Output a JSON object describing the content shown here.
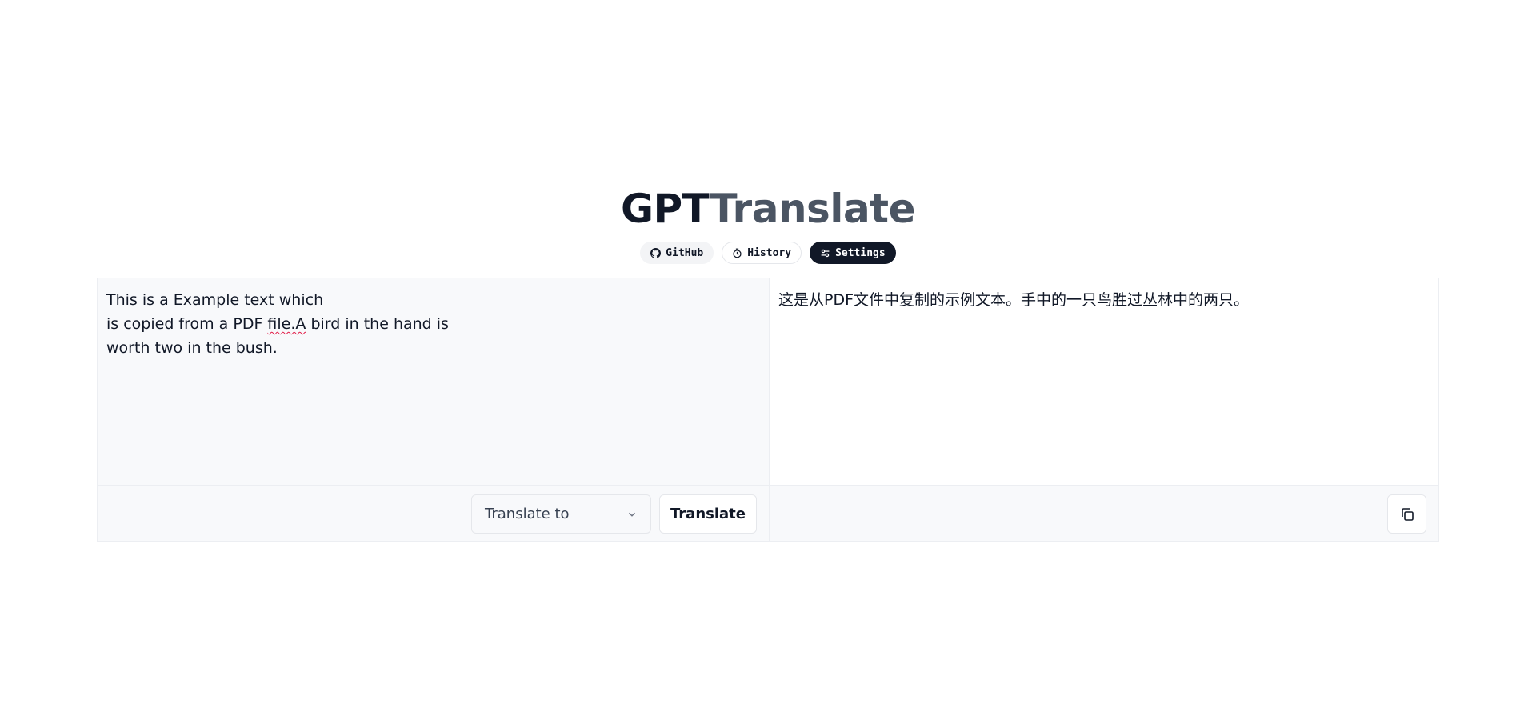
{
  "header": {
    "title_part_a": "GPT",
    "title_part_b": "Translate",
    "nav": {
      "github_label": "GitHub",
      "history_label": "History",
      "settings_label": "Settings"
    }
  },
  "source": {
    "line_1": "This is a Example text which",
    "line_2_before": "is copied from a PDF ",
    "line_2_misspelled": "file.A",
    "line_2_after": " bird in the hand is",
    "line_3": "worth two in the bush."
  },
  "target": {
    "text": "这是从PDF文件中复制的示例文本。手中的一只鸟胜过丛林中的两只。"
  },
  "controls": {
    "language_select_value": "Translate to",
    "translate_label": "Translate"
  },
  "colors": {
    "dark": "#111827",
    "title_accent": "#4b5563",
    "panel_bg": "#f8f9fb",
    "spellcheck": "#e11d48"
  },
  "icons": {
    "github": "github-icon",
    "history": "history-icon",
    "settings": "settings-icon",
    "chevron": "chevron-down-icon",
    "copy": "copy-icon"
  }
}
